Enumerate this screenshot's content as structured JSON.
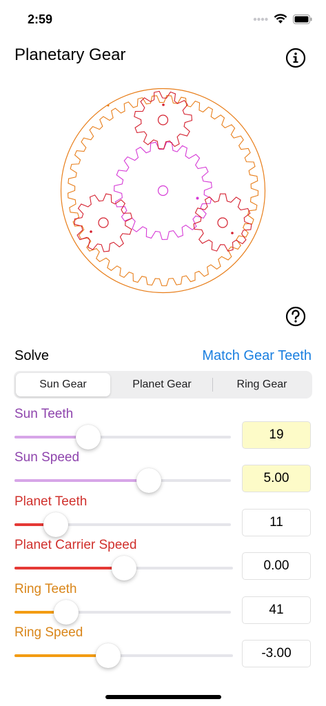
{
  "status": {
    "time": "2:59"
  },
  "header": {
    "title": "Planetary Gear"
  },
  "solve": {
    "label": "Solve",
    "match_link": "Match Gear Teeth"
  },
  "tabs": [
    {
      "label": "Sun Gear",
      "active": true
    },
    {
      "label": "Planet Gear",
      "active": false
    },
    {
      "label": "Ring Gear",
      "active": false
    }
  ],
  "params": [
    {
      "label": "Sun Teeth",
      "value": "19",
      "color": "#8e44ad",
      "fill_color": "#d7a6e8",
      "slider_fraction": 0.34,
      "highlight": true
    },
    {
      "label": "Sun Speed",
      "value": "5.00",
      "color": "#8e44ad",
      "fill_color": "#d7a6e8",
      "slider_fraction": 0.62,
      "highlight": true
    },
    {
      "label": "Planet Teeth",
      "value": "11",
      "color": "#d0312d",
      "fill_color": "#e53935",
      "slider_fraction": 0.19,
      "highlight": false
    },
    {
      "label": "Planet Carrier Speed",
      "value": "0.00",
      "color": "#d0312d",
      "fill_color": "#e53935",
      "slider_fraction": 0.5,
      "highlight": false
    },
    {
      "label": "Ring Teeth",
      "value": "41",
      "color": "#d9861a",
      "fill_color": "#f39c12",
      "slider_fraction": 0.24,
      "highlight": false
    },
    {
      "label": "Ring Speed",
      "value": "-3.00",
      "color": "#d9861a",
      "fill_color": "#f39c12",
      "slider_fraction": 0.43,
      "highlight": false
    }
  ],
  "gears": {
    "sun": {
      "teeth": 19,
      "color": "#d63ad6"
    },
    "planet": {
      "teeth": 11,
      "color": "#d41f2e"
    },
    "ring": {
      "teeth": 41,
      "color": "#e87e1a"
    }
  },
  "icons": {
    "info": "info-icon",
    "help": "help-icon",
    "wifi": "wifi-icon",
    "battery": "battery-icon",
    "signal": "signal-icon"
  }
}
